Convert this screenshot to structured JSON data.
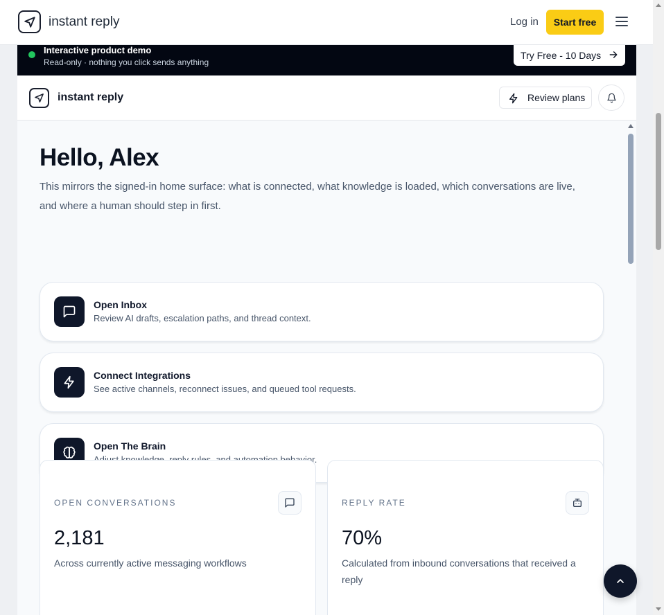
{
  "site": {
    "brand": "instant reply",
    "login": "Log in",
    "start": "Start free"
  },
  "banner": {
    "title": "Interactive product demo",
    "subtitle": "Read-only · nothing you click sends anything",
    "try_label": "Try Free - 10 Days"
  },
  "app": {
    "brand": "instant reply",
    "review_label": "Review plans"
  },
  "main": {
    "greeting": "Hello, Alex",
    "intro": "This mirrors the signed-in home surface: what is connected, what knowledge is loaded, which conversations are live, and where a human should step in first.",
    "actions": [
      {
        "title": "Open Inbox",
        "desc": "Review AI drafts, escalation paths, and thread context.",
        "icon": "message-square-icon"
      },
      {
        "title": "Connect Integrations",
        "desc": "See active channels, reconnect issues, and queued tool requests.",
        "icon": "zap-icon"
      },
      {
        "title": "Open The Brain",
        "desc": "Adjust knowledge, reply rules, and automation behavior.",
        "icon": "brain-icon"
      }
    ],
    "stats": [
      {
        "label": "OPEN CONVERSATIONS",
        "value": "2,181",
        "desc": "Across currently active messaging workflows",
        "icon": "message-square-icon"
      },
      {
        "label": "REPLY RATE",
        "value": "70%",
        "desc": "Calculated from inbound conversations that received a reply",
        "icon": "bot-icon"
      }
    ]
  },
  "colors": {
    "accent": "#facc15",
    "dark": "#0f172a",
    "banner": "#030712",
    "live_dot": "#22c55e"
  }
}
